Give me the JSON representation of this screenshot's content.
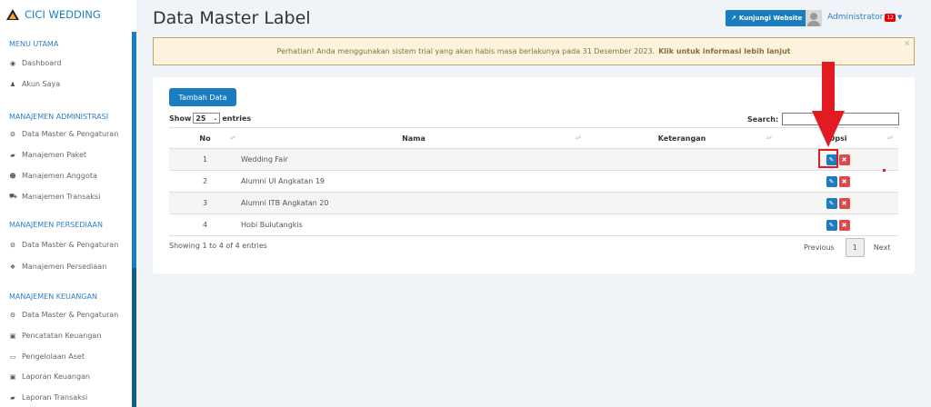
{
  "brand": "CICI WEDDING",
  "sidebar": {
    "sections": [
      {
        "title": "MENU UTAMA",
        "items": [
          {
            "label": "Dashboard",
            "icon": "globe-icon"
          },
          {
            "label": "Akun Saya",
            "icon": "user-icon"
          }
        ]
      },
      {
        "title": "MANAJEMEN ADMINISTRASI",
        "items": [
          {
            "label": "Data Master & Pengaturan",
            "icon": "cogs-icon"
          },
          {
            "label": "Manajemen Paket",
            "icon": "book-icon"
          },
          {
            "label": "Manajemen Anggota",
            "icon": "users-icon"
          },
          {
            "label": "Manajemen Transaksi",
            "icon": "cart-icon"
          }
        ]
      },
      {
        "title": "MANAJEMEN PERSEDIAAN",
        "items": [
          {
            "label": "Data Master & Pengaturan",
            "icon": "cogs-icon"
          },
          {
            "label": "Manajemen Persediaan",
            "icon": "cubes-icon"
          }
        ]
      },
      {
        "title": "MANAJEMEN KEUANGAN",
        "items": [
          {
            "label": "Data Master & Pengaturan",
            "icon": "cogs-icon"
          },
          {
            "label": "Pencatatan Keuangan",
            "icon": "money-icon"
          },
          {
            "label": "Pengelolaan Aset",
            "icon": "laptop-icon"
          },
          {
            "label": "Laporan Keuangan",
            "icon": "money-icon"
          },
          {
            "label": "Laporan Transaksi",
            "icon": "book-icon"
          }
        ]
      }
    ]
  },
  "header": {
    "title": "Data Master Label",
    "visit": "Kunjungi Website",
    "user": "Administrator",
    "badge": "12"
  },
  "alert": {
    "text": "Perhatian! Anda menggunakan sistem trial yang akan habis masa berlakunya pada 31 Desember 2023.",
    "link": "Klik untuk informasi lebih lanjut",
    "close": "×"
  },
  "table": {
    "add": "Tambah Data",
    "show": "Show",
    "length": "25",
    "entries": "entries",
    "search": "Search:",
    "columns": [
      "No",
      "Nama",
      "Keterangan",
      "Opsi"
    ],
    "rows": [
      {
        "no": "1",
        "nama": "Wedding Fair",
        "ket": ""
      },
      {
        "no": "2",
        "nama": "Alumni UI Angkatan 19",
        "ket": ""
      },
      {
        "no": "3",
        "nama": "Alumni ITB Angkatan 20",
        "ket": ""
      },
      {
        "no": "4",
        "nama": "Hobi Bulutangkis",
        "ket": ""
      }
    ],
    "info": "Showing 1 to 4 of 4 entries",
    "prev": "Previous",
    "page": "1",
    "next": "Next"
  },
  "colors": {
    "primary": "#1a7dc0",
    "danger": "#e04848",
    "annotation": "#e21b23"
  }
}
